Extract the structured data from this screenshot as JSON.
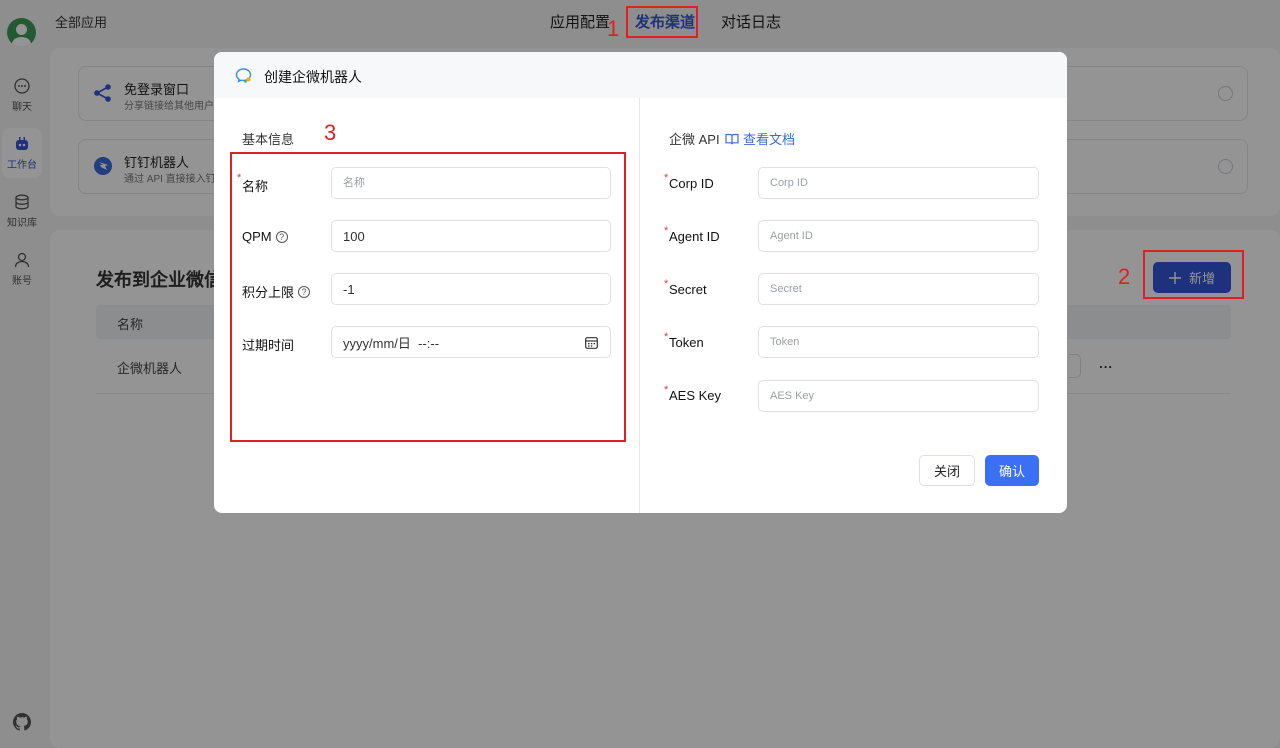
{
  "app": {
    "breadcrumb": "全部应用",
    "sidebar": [
      {
        "label": "聊天",
        "icon": "chat-icon"
      },
      {
        "label": "工作台",
        "icon": "robot-icon"
      },
      {
        "label": "知识库",
        "icon": "database-icon"
      },
      {
        "label": "账号",
        "icon": "user-icon"
      }
    ],
    "tabs": [
      "应用配置",
      "发布渠道",
      "对话日志"
    ],
    "active_tab": "发布渠道",
    "channels": [
      {
        "title": "免登录窗口",
        "desc": "分享链接给其他用户",
        "icon": "share-icon"
      },
      {
        "title": "钉钉机器人",
        "desc": "通过 API 直接接入钉",
        "icon": "dingtalk-icon"
      }
    ],
    "list_title": "发布到企业微信",
    "add_button": "新增",
    "table_header": "名称",
    "table_rows": [
      {
        "name": "企微机器人",
        "more": "..."
      }
    ]
  },
  "modal": {
    "title": "创建企微机器人",
    "basic_info": "基本信息",
    "api_section": "企微 API",
    "doc_link": "查看文档",
    "left_fields": [
      {
        "label": "名称",
        "required": true,
        "value": "",
        "placeholder": "名称"
      },
      {
        "label": "QPM",
        "help": true,
        "value": "100"
      },
      {
        "label": "积分上限",
        "help": true,
        "value": "-1"
      },
      {
        "label": "过期时间",
        "value": "yyyy/mm/日  --:--"
      }
    ],
    "right_fields": [
      {
        "label": "Corp ID",
        "required": true,
        "placeholder": "Corp ID"
      },
      {
        "label": "Agent ID",
        "required": true,
        "placeholder": "Agent ID"
      },
      {
        "label": "Secret",
        "required": true,
        "placeholder": "Secret"
      },
      {
        "label": "Token",
        "required": true,
        "placeholder": "Token"
      },
      {
        "label": "AES Key",
        "required": true,
        "placeholder": "AES Key"
      }
    ],
    "close_button": "关闭",
    "confirm_button": "确认"
  },
  "annotations": [
    "1",
    "2",
    "3"
  ],
  "colors": {
    "primary": "#3455d6",
    "confirm": "#3b6ff5",
    "annotation": "#e02020",
    "link": "#3a6bdb"
  }
}
